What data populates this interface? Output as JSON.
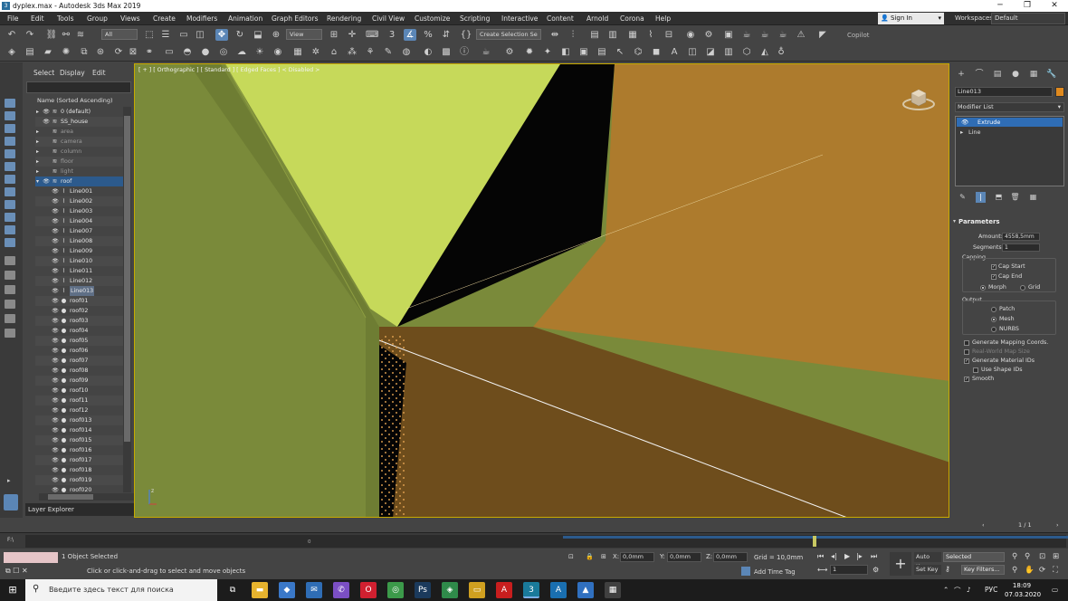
{
  "window": {
    "title": "dyplex.max - Autodesk 3ds Max 2019",
    "minimize_glyph": "─",
    "maximize_glyph": "❐",
    "close_glyph": "✕"
  },
  "menu": [
    "File",
    "Edit",
    "Tools",
    "Group",
    "Views",
    "Create",
    "Modifiers",
    "Animation",
    "Graph Editors",
    "Rendering",
    "Civil View",
    "Customize",
    "Scripting",
    "Interactive",
    "Content",
    "Arnold",
    "Corona",
    "Help"
  ],
  "account": {
    "sign_in": "Sign In",
    "workspaces_label": "Workspaces:",
    "workspace_value": "Default"
  },
  "toolbar": {
    "selection_filter": "All",
    "ref_coord": "View",
    "selection_set": "Create Selection Se",
    "copilot": "Copilot"
  },
  "scene_explorer": {
    "tabs": [
      "Select",
      "Display",
      "Edit"
    ],
    "sort_header": "Name (Sorted Ascending)",
    "items": [
      {
        "label": "0 (default)",
        "level": 0,
        "kind": "layer",
        "arrow": "▸",
        "eye": true
      },
      {
        "label": "SS_house",
        "level": 0,
        "kind": "layer",
        "arrow": "",
        "eye": true
      },
      {
        "label": "area",
        "level": 0,
        "kind": "layer",
        "arrow": "▸",
        "eye": false
      },
      {
        "label": "camera",
        "level": 0,
        "kind": "layer",
        "arrow": "▸",
        "eye": false
      },
      {
        "label": "column",
        "level": 0,
        "kind": "layer",
        "arrow": "▸",
        "eye": false
      },
      {
        "label": "floor",
        "level": 0,
        "kind": "layer",
        "arrow": "▸",
        "eye": false
      },
      {
        "label": "light",
        "level": 0,
        "kind": "layer",
        "arrow": "▸",
        "eye": false
      },
      {
        "label": "roof",
        "level": 0,
        "kind": "layer",
        "arrow": "▾",
        "eye": true,
        "selected": true
      },
      {
        "label": "Line001",
        "level": 1,
        "kind": "shape",
        "eye": true
      },
      {
        "label": "Line002",
        "level": 1,
        "kind": "shape",
        "eye": true
      },
      {
        "label": "Line003",
        "level": 1,
        "kind": "shape",
        "eye": true
      },
      {
        "label": "Line004",
        "level": 1,
        "kind": "shape",
        "eye": true
      },
      {
        "label": "Line007",
        "level": 1,
        "kind": "shape",
        "eye": true
      },
      {
        "label": "Line008",
        "level": 1,
        "kind": "shape",
        "eye": true
      },
      {
        "label": "Line009",
        "level": 1,
        "kind": "shape",
        "eye": true
      },
      {
        "label": "Line010",
        "level": 1,
        "kind": "shape",
        "eye": true
      },
      {
        "label": "Line011",
        "level": 1,
        "kind": "shape",
        "eye": true
      },
      {
        "label": "Line012",
        "level": 1,
        "kind": "shape",
        "eye": true
      },
      {
        "label": "Line013",
        "level": 1,
        "kind": "shape",
        "eye": true,
        "highlight": true
      },
      {
        "label": "roof01",
        "level": 1,
        "kind": "object",
        "eye": true
      },
      {
        "label": "roof02",
        "level": 1,
        "kind": "object",
        "eye": true
      },
      {
        "label": "roof03",
        "level": 1,
        "kind": "object",
        "eye": true
      },
      {
        "label": "roof04",
        "level": 1,
        "kind": "object",
        "eye": true
      },
      {
        "label": "roof05",
        "level": 1,
        "kind": "object",
        "eye": true
      },
      {
        "label": "roof06",
        "level": 1,
        "kind": "object",
        "eye": true
      },
      {
        "label": "roof07",
        "level": 1,
        "kind": "object",
        "eye": true
      },
      {
        "label": "roof08",
        "level": 1,
        "kind": "object",
        "eye": true
      },
      {
        "label": "roof09",
        "level": 1,
        "kind": "object",
        "eye": true
      },
      {
        "label": "roof10",
        "level": 1,
        "kind": "object",
        "eye": true
      },
      {
        "label": "roof11",
        "level": 1,
        "kind": "object",
        "eye": true
      },
      {
        "label": "roof12",
        "level": 1,
        "kind": "object",
        "eye": true
      },
      {
        "label": "roof013",
        "level": 1,
        "kind": "object",
        "eye": true
      },
      {
        "label": "roof014",
        "level": 1,
        "kind": "object",
        "eye": true
      },
      {
        "label": "roof015",
        "level": 1,
        "kind": "object",
        "eye": true
      },
      {
        "label": "roof016",
        "level": 1,
        "kind": "object",
        "eye": true
      },
      {
        "label": "roof017",
        "level": 1,
        "kind": "object",
        "eye": true
      },
      {
        "label": "roof018",
        "level": 1,
        "kind": "object",
        "eye": true
      },
      {
        "label": "roof019",
        "level": 1,
        "kind": "object",
        "eye": true
      },
      {
        "label": "roof020",
        "level": 1,
        "kind": "object",
        "eye": true
      }
    ],
    "layer_explorer": "Layer Explorer"
  },
  "viewport": {
    "label": "[ + ] [ Orthographic ] [ Standard ] [ Edged Faces ]  < Disabled >",
    "colors": {
      "wall_left": "#7a8a3a",
      "wall_left_dark": "#6e7d33",
      "roof_light": "#c6d95a",
      "roof_orange": "#ad7b2d",
      "roof_orange_dark": "#6e4d1c",
      "black": "#050505",
      "frame": "#c8aa00"
    }
  },
  "command_panel": {
    "tab_icons": [
      "+",
      "⌒",
      "▤",
      "●",
      "▦",
      "🔧"
    ],
    "object_name": "Line013",
    "object_color": "#e08a1e",
    "modifier_list": "Modifier List",
    "stack": [
      "Extrude",
      "Line"
    ],
    "parameters": {
      "title": "Parameters",
      "amount_label": "Amount:",
      "amount_value": "4558,5mm",
      "segments_label": "Segments:",
      "segments_value": "1",
      "capping_label": "Capping",
      "cap_start": "Cap Start",
      "cap_end": "Cap End",
      "morph": "Morph",
      "grid": "Grid",
      "output_label": "Output",
      "patch": "Patch",
      "mesh": "Mesh",
      "nurbs": "NURBS",
      "gen_mapping": "Generate Mapping Coords.",
      "real_world": "Real-World Map Size",
      "gen_matids": "Generate Material IDs",
      "use_shape_ids": "Use Shape IDs",
      "smooth": "Smooth"
    },
    "page": "1 / 1"
  },
  "timeline": {
    "frame_zero": "0",
    "label": "F:\\"
  },
  "status": {
    "selection": "1 Object Selected",
    "prompt": "Click or click-and-drag to select and move objects",
    "x_label": "X:",
    "x_value": "0,0mm",
    "y_label": "Y:",
    "y_value": "0,0mm",
    "z_label": "Z:",
    "z_value": "0,0mm",
    "grid": "Grid = 10,0mm",
    "add_time_tag": "Add Time Tag",
    "frame_value": "1",
    "auto_key": "Auto Key",
    "set_key": "Set Key",
    "selected_dropdown": "Selected",
    "key_filters": "Key Filters..."
  },
  "taskbar": {
    "search_placeholder": "Введите здесь текст для поиска",
    "lang": "РУС",
    "time": "18:09",
    "date": "07.03.2020",
    "apps": [
      {
        "name": "task-view",
        "glyph": "⧉",
        "color": "#1c1c1c"
      },
      {
        "name": "file-explorer",
        "glyph": "▬",
        "color": "#e6b32e"
      },
      {
        "name": "store",
        "glyph": "◆",
        "color": "#3a78c8"
      },
      {
        "name": "mail",
        "glyph": "✉",
        "color": "#2f6db5"
      },
      {
        "name": "viber",
        "glyph": "✆",
        "color": "#7b4fc4"
      },
      {
        "name": "opera",
        "glyph": "O",
        "color": "#d02030"
      },
      {
        "name": "chrome",
        "glyph": "◎",
        "color": "#3c9a4a"
      },
      {
        "name": "photoshop",
        "glyph": "Ps",
        "color": "#1b3a5c"
      },
      {
        "name": "corel",
        "glyph": "◈",
        "color": "#2f8a4a"
      },
      {
        "name": "folder",
        "glyph": "▭",
        "color": "#d0a020"
      },
      {
        "name": "acrobat",
        "glyph": "A",
        "color": "#c81e1e"
      },
      {
        "name": "3dsmax",
        "glyph": "3",
        "color": "#1a7a9a"
      },
      {
        "name": "autocad",
        "glyph": "A",
        "color": "#1a6fb0"
      },
      {
        "name": "photos",
        "glyph": "▲",
        "color": "#3070c0"
      },
      {
        "name": "calculator",
        "glyph": "▦",
        "color": "#404040"
      }
    ]
  }
}
